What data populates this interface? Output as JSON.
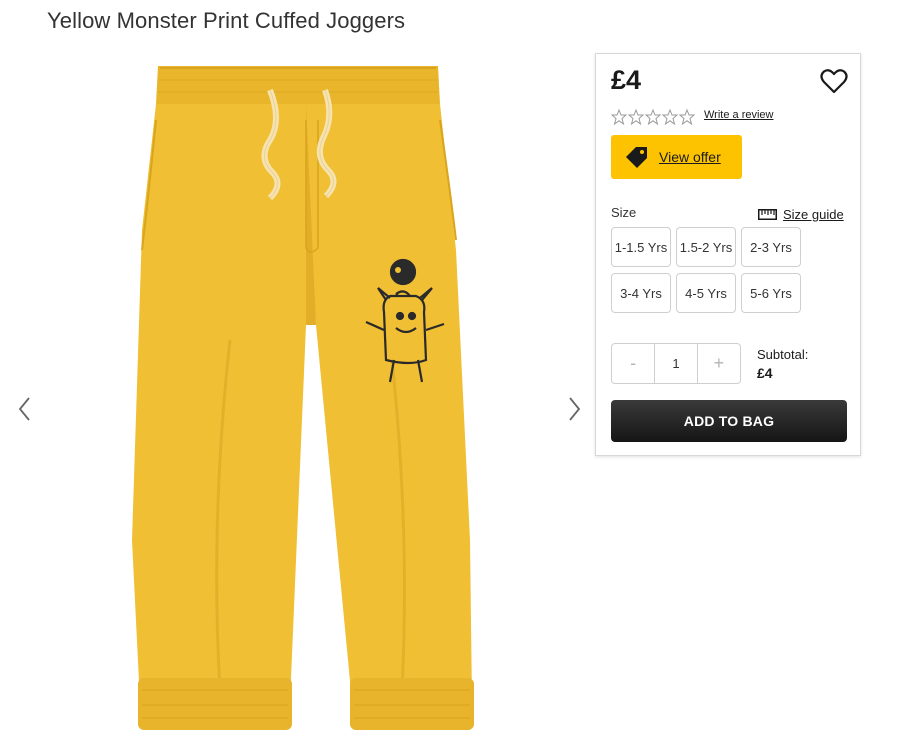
{
  "product": {
    "title": "Yellow Monster Print Cuffed Joggers",
    "image_alt": "Yellow joggers with monster print",
    "colors": {
      "garment": "#f0bf33",
      "garment_shadow": "#dfac24",
      "accent": "#fdc300"
    }
  },
  "gallery": {
    "prev_icon": "chevron-left-icon",
    "next_icon": "chevron-right-icon"
  },
  "purchase": {
    "price": "£4",
    "wishlist_icon": "heart-icon",
    "rating": {
      "stars_filled": 0,
      "stars_total": 5
    },
    "write_review_label": "Write a review",
    "offer": {
      "icon": "tag-icon",
      "label": "View offer"
    },
    "size_label": "Size",
    "size_guide": {
      "icon": "ruler-icon",
      "label": "Size guide"
    },
    "sizes": [
      "1-1.5 Yrs",
      "1.5-2 Yrs",
      "2-3 Yrs",
      "3-4 Yrs",
      "4-5 Yrs",
      "5-6 Yrs"
    ],
    "quantity": {
      "minus": "-",
      "value": "1",
      "plus": "+"
    },
    "subtotal_label": "Subtotal:",
    "subtotal_value": "£4",
    "add_to_bag_label": "ADD TO BAG"
  }
}
